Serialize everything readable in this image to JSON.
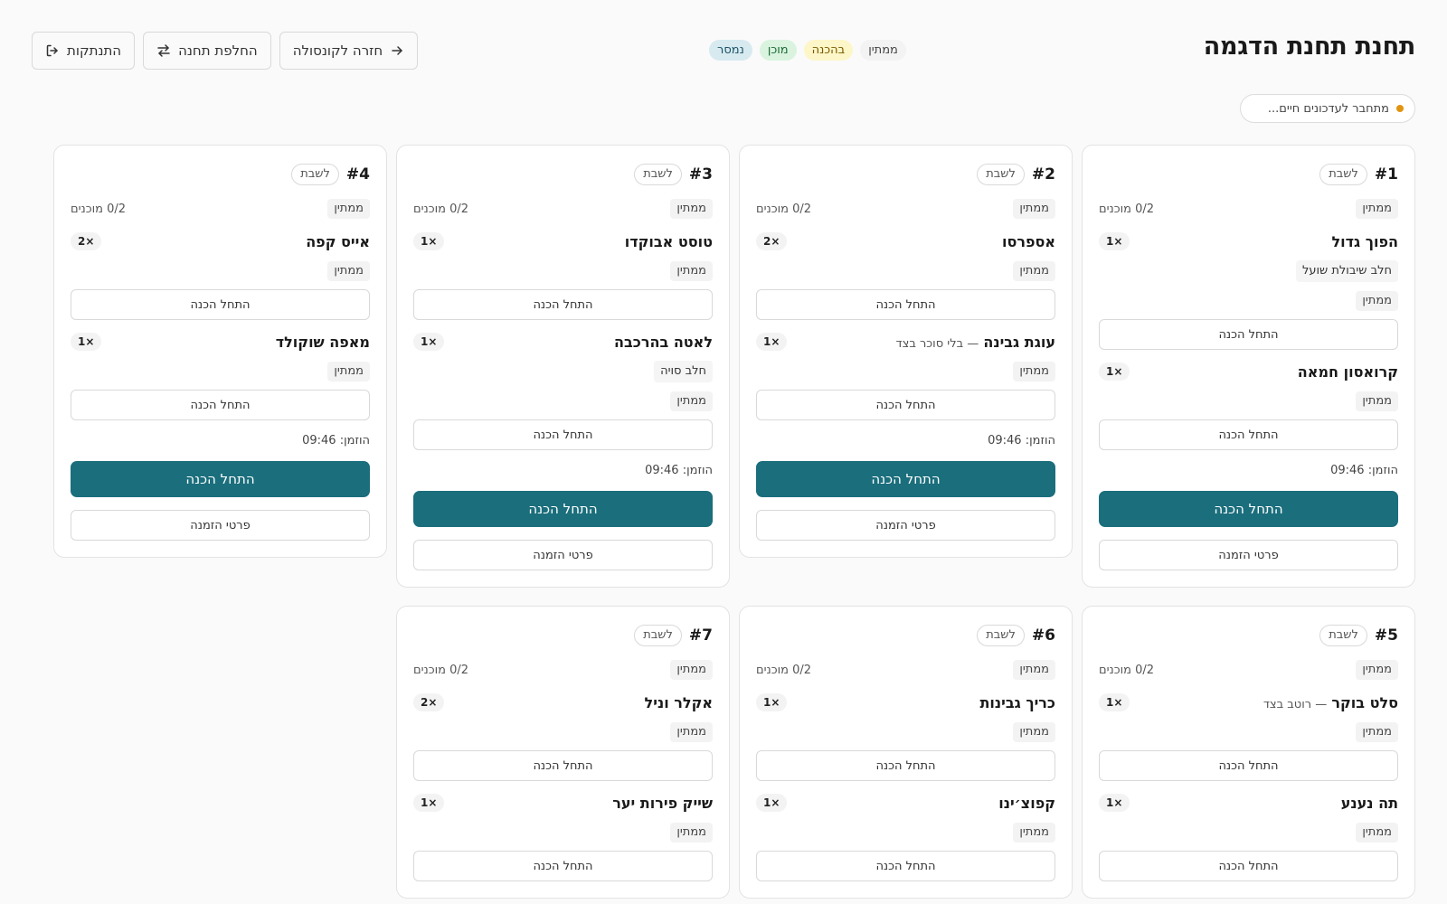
{
  "header": {
    "title": "תחנת תחנת הדגמה",
    "legend": {
      "waiting": "ממתין",
      "preparing": "בהכנה",
      "ready": "מוכן",
      "delivered": "נמסר"
    },
    "actions": {
      "back": "חזרה לקונסולה",
      "switch": "החלפת תחנה",
      "logout": "התנתקות"
    },
    "connection": "מתחבר לעדכונים חיים..."
  },
  "cards": [
    {
      "num": "#1",
      "seat": "לשבת",
      "status": "ממתין",
      "ready": "0/2 מוכנים",
      "items": [
        {
          "name": "הפוך גדול",
          "note": "",
          "qty": "1×",
          "mod": "חלב שיבולת שועל",
          "status": "ממתין",
          "btn": "התחל הכנה"
        },
        {
          "name": "קרואסון חמאה",
          "note": "",
          "qty": "1×",
          "mod": "",
          "status": "ממתין",
          "btn": "התחל הכנה"
        }
      ],
      "ordered": "הוזמן: 09:46",
      "start": "התחל הכנה",
      "details": "פרטי הזמנה"
    },
    {
      "num": "#2",
      "seat": "לשבת",
      "status": "ממתין",
      "ready": "0/2 מוכנים",
      "items": [
        {
          "name": "אספרסו",
          "note": "",
          "qty": "2×",
          "mod": "",
          "status": "ממתין",
          "btn": "התחל הכנה"
        },
        {
          "name": "עוגת גבינה",
          "note": "— בלי סוכר בצד",
          "qty": "1×",
          "mod": "",
          "status": "ממתין",
          "btn": "התחל הכנה"
        }
      ],
      "ordered": "הוזמן: 09:46",
      "start": "התחל הכנה",
      "details": "פרטי הזמנה"
    },
    {
      "num": "#3",
      "seat": "לשבת",
      "status": "ממתין",
      "ready": "0/2 מוכנים",
      "items": [
        {
          "name": "טוסט אבוקדו",
          "note": "",
          "qty": "1×",
          "mod": "",
          "status": "ממתין",
          "btn": "התחל הכנה"
        },
        {
          "name": "לאטה בהרכבה",
          "note": "",
          "qty": "1×",
          "mod": "חלב סויה",
          "status": "ממתין",
          "btn": "התחל הכנה"
        }
      ],
      "ordered": "הוזמן: 09:46",
      "start": "התחל הכנה",
      "details": "פרטי הזמנה"
    },
    {
      "num": "#4",
      "seat": "לשבת",
      "status": "ממתין",
      "ready": "0/2 מוכנים",
      "items": [
        {
          "name": "אייס קפה",
          "note": "",
          "qty": "2×",
          "mod": "",
          "status": "ממתין",
          "btn": "התחל הכנה"
        },
        {
          "name": "מאפה שוקולד",
          "note": "",
          "qty": "1×",
          "mod": "",
          "status": "ממתין",
          "btn": "התחל הכנה"
        }
      ],
      "ordered": "הוזמן: 09:46",
      "start": "התחל הכנה",
      "details": "פרטי הזמנה"
    },
    {
      "num": "#5",
      "seat": "לשבת",
      "status": "ממתין",
      "ready": "0/2 מוכנים",
      "items": [
        {
          "name": "סלט בוקר",
          "note": "— רוטב בצד",
          "qty": "1×",
          "mod": "",
          "status": "ממתין",
          "btn": "התחל הכנה"
        },
        {
          "name": "תה נענע",
          "note": "",
          "qty": "1×",
          "mod": "",
          "status": "ממתין",
          "btn": "התחל הכנה"
        }
      ]
    },
    {
      "num": "#6",
      "seat": "לשבת",
      "status": "ממתין",
      "ready": "0/2 מוכנים",
      "items": [
        {
          "name": "כריך גבינות",
          "note": "",
          "qty": "1×",
          "mod": "",
          "status": "ממתין",
          "btn": "התחל הכנה"
        },
        {
          "name": "קפוצ׳ינו",
          "note": "",
          "qty": "1×",
          "mod": "",
          "status": "ממתין",
          "btn": "התחל הכנה"
        }
      ]
    },
    {
      "num": "#7",
      "seat": "לשבת",
      "status": "ממתין",
      "ready": "0/2 מוכנים",
      "items": [
        {
          "name": "אקלר וניל",
          "note": "",
          "qty": "2×",
          "mod": "",
          "status": "ממתין",
          "btn": "התחל הכנה"
        },
        {
          "name": "שייק פירות יער",
          "note": "",
          "qty": "1×",
          "mod": "",
          "status": "ממתין",
          "btn": "התחל הכנה"
        }
      ]
    }
  ],
  "colors": {
    "primary": "#1b6e7c",
    "connection_dot": "#e0940f"
  }
}
